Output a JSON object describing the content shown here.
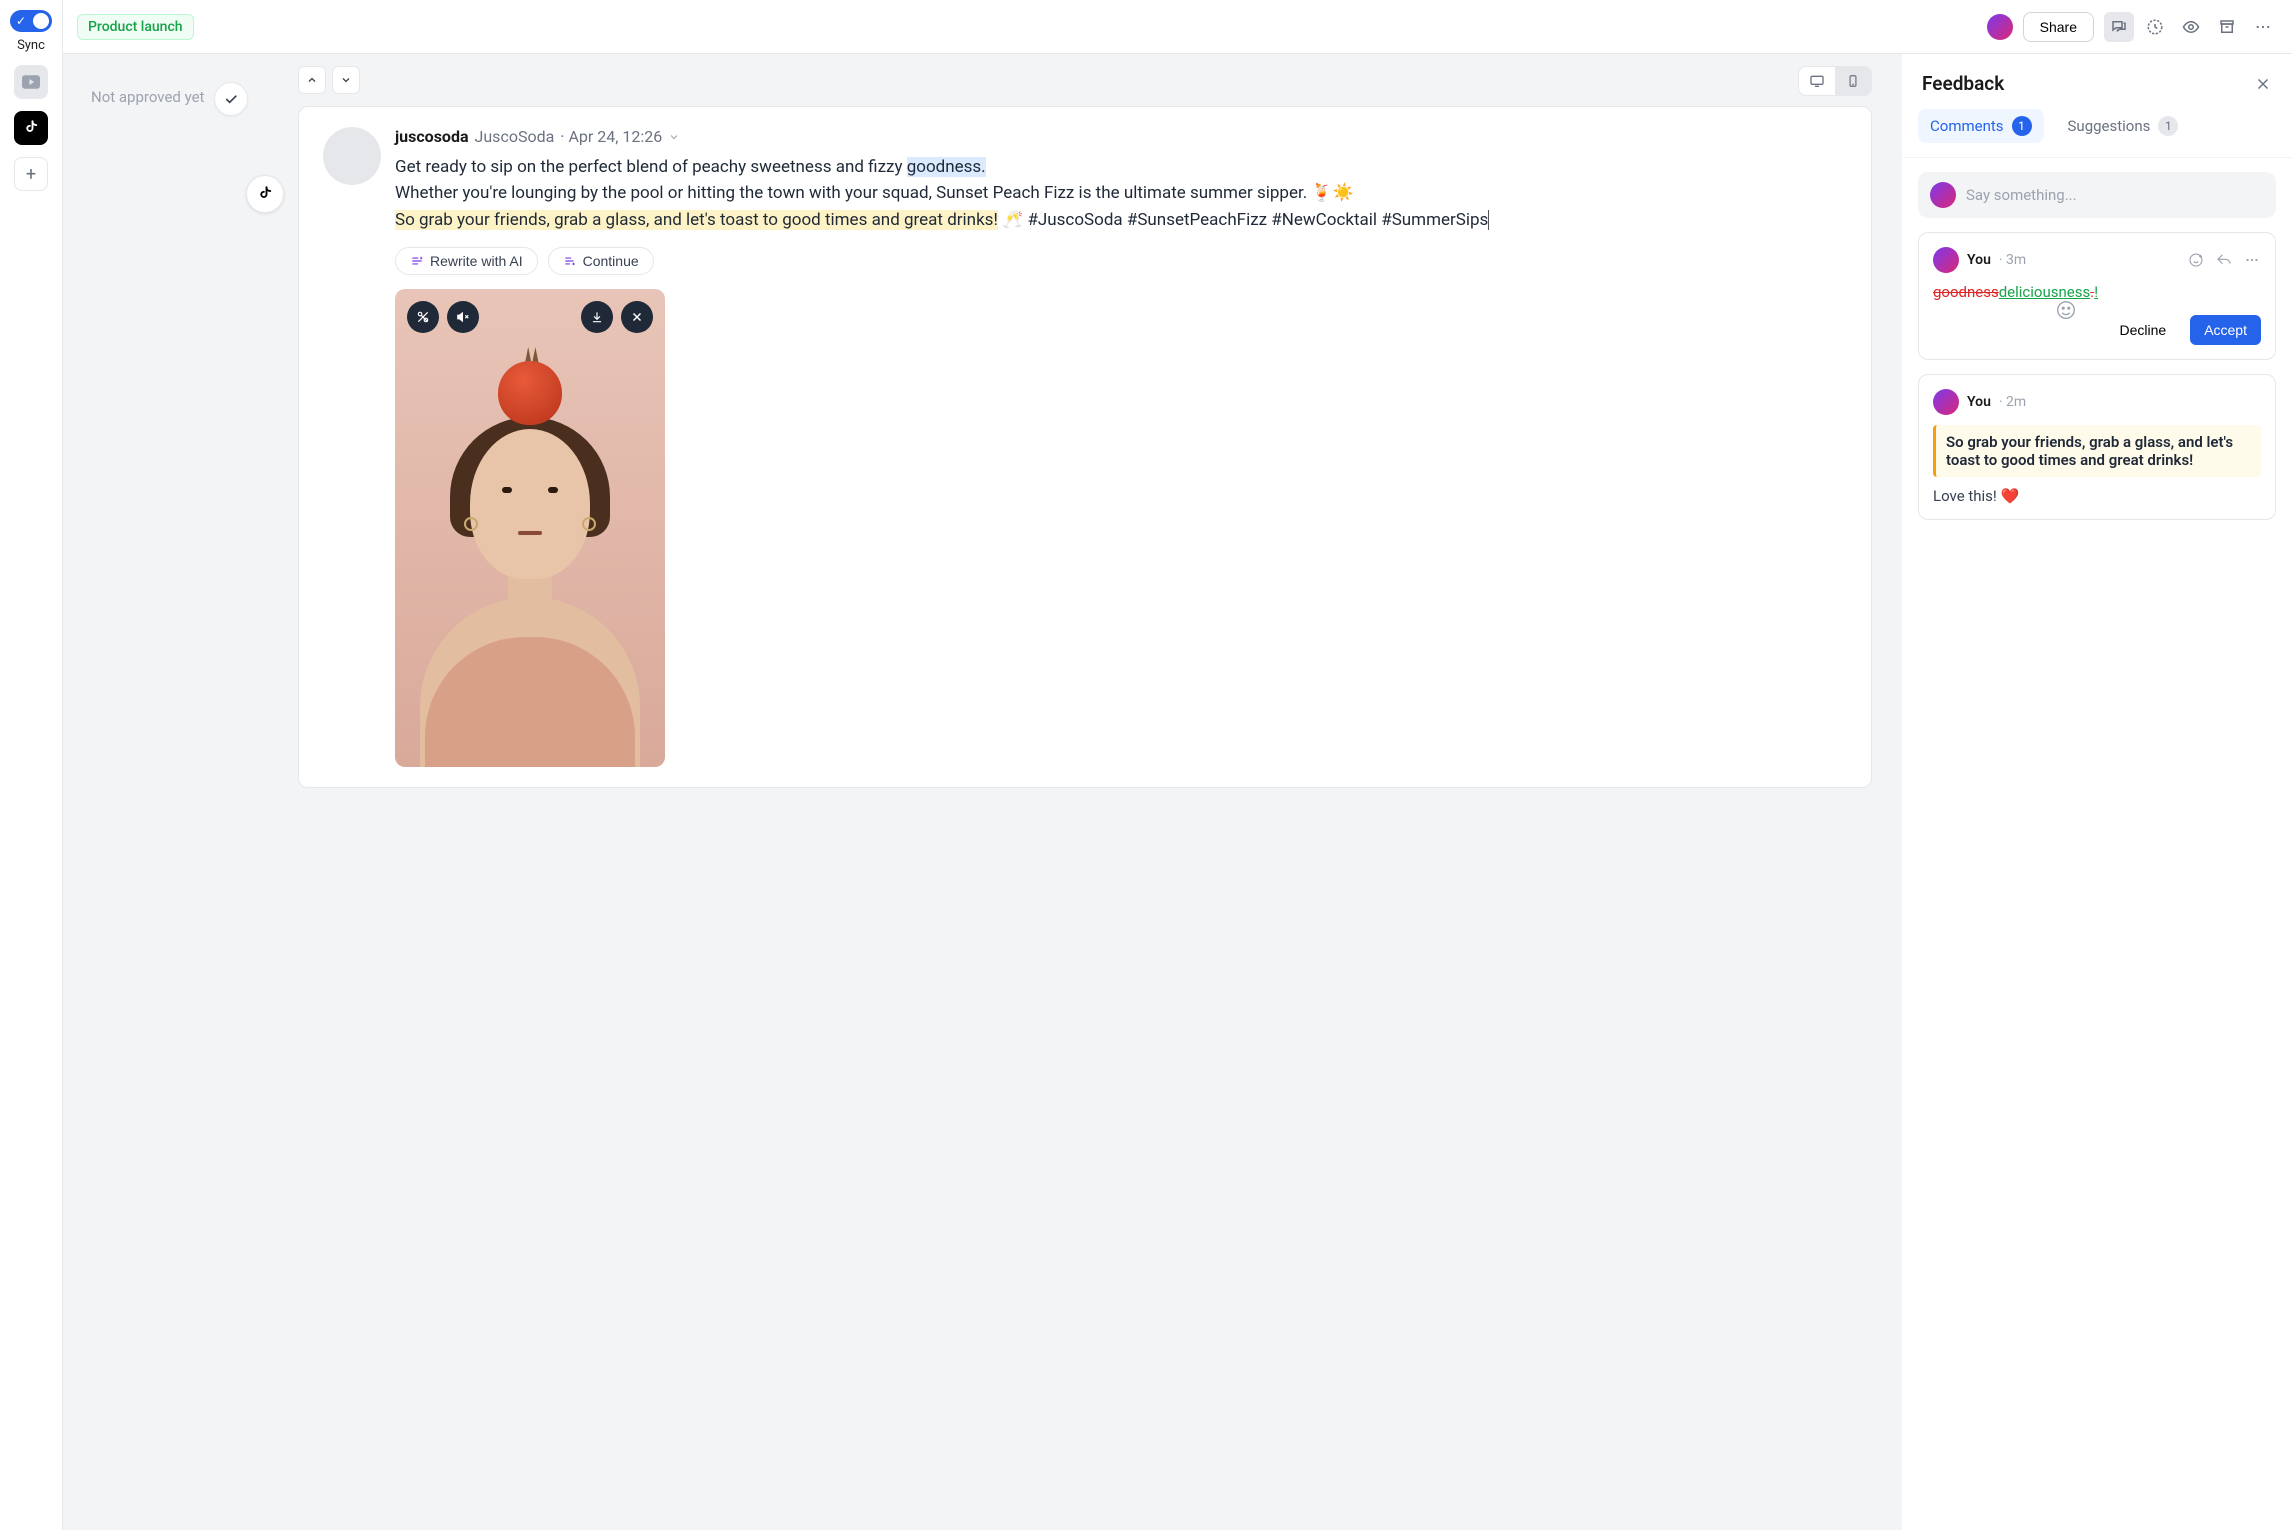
{
  "sync_label": "Sync",
  "topbar": {
    "tag": "Product launch",
    "share": "Share"
  },
  "approval": {
    "status": "Not approved yet"
  },
  "post": {
    "handle": "juscosoda",
    "display_name": "JuscoSoda",
    "date": "· Apr 24, 12:26",
    "line1_a": "Get ready to sip on the perfect blend of peachy sweetness and fizzy ",
    "line1_hl": "goodness.",
    "line2": "Whether you're lounging by the pool or hitting the town with your squad, Sunset Peach Fizz is the ultimate summer sipper. 🍹☀️",
    "line3_hl": "So grab your friends, grab a glass, and let's toast to good times and great drinks!",
    "line3_b": " 🥂 #JuscoSoda #SunsetPeachFizz #NewCocktail #SummerSips",
    "rewrite": "Rewrite with AI",
    "continue": "Continue"
  },
  "feedback": {
    "title": "Feedback",
    "tab_comments": "Comments",
    "tab_comments_count": "1",
    "tab_suggestions": "Suggestions",
    "tab_suggestions_count": "1",
    "input_placeholder": "Say something...",
    "c1": {
      "author": "You",
      "time": "· 3m",
      "strike": "goodness",
      "insert": "deliciousness",
      "punct_strike": ".",
      "punct_insert": "!",
      "decline": "Decline",
      "accept": "Accept"
    },
    "c2": {
      "author": "You",
      "time": "· 2m",
      "quote": "So grab your friends, grab a glass, and let's toast to good times and great drinks!",
      "text": "Love this! ❤️"
    }
  }
}
